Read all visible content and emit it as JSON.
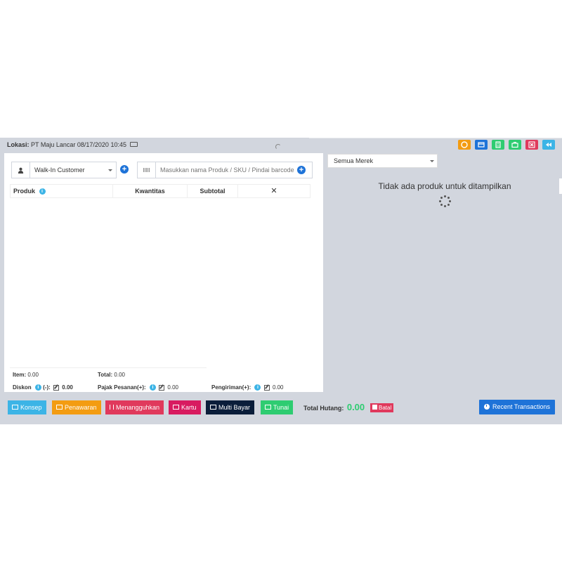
{
  "location": {
    "label": "Lokasi:",
    "value": "PT Maju Lancar 08/17/2020 10:45"
  },
  "toolbar": {
    "buttons": [
      {
        "name": "money-icon",
        "color": "#f39c12"
      },
      {
        "name": "card-icon",
        "color": "#1e73d8"
      },
      {
        "name": "calculator-icon",
        "color": "#2ecc71"
      },
      {
        "name": "briefcase-icon",
        "color": "#2ecc71"
      },
      {
        "name": "close-icon",
        "color": "#e0395c"
      },
      {
        "name": "backward-icon",
        "color": "#3cb4e6"
      }
    ]
  },
  "customer": {
    "selected": "Walk-In Customer"
  },
  "product_search": {
    "placeholder": "Masukkan nama Produk / SKU / Pindai barcode"
  },
  "table": {
    "headers": {
      "product": "Produk",
      "quantity": "Kwantitas",
      "subtotal": "Subtotal",
      "remove": "✕"
    }
  },
  "summary": {
    "item_label": "Item:",
    "item_value": "0.00",
    "total_label": "Total:",
    "total_value": "0.00",
    "discount_label": "Diskon",
    "discount_sign": "(-):",
    "discount_value": "0.00",
    "tax_label": "Pajak Pesanan(+):",
    "tax_value": "0.00",
    "shipping_label": "Pengiriman(+):",
    "shipping_value": "0.00"
  },
  "brand_filter": {
    "selected": "Semua Merek"
  },
  "products": {
    "empty_message": "Tidak ada produk untuk ditampilkan"
  },
  "actions": {
    "draft": "Konsep",
    "quotation": "Penawaran",
    "suspend": "Menangguhkan",
    "card": "Kartu",
    "multi_pay": "Multi Bayar",
    "cash": "Tunai",
    "total_due_label": "Total Hutang:",
    "total_due_value": "0.00",
    "cancel": "Batal",
    "recent": "Recent Transactions"
  }
}
